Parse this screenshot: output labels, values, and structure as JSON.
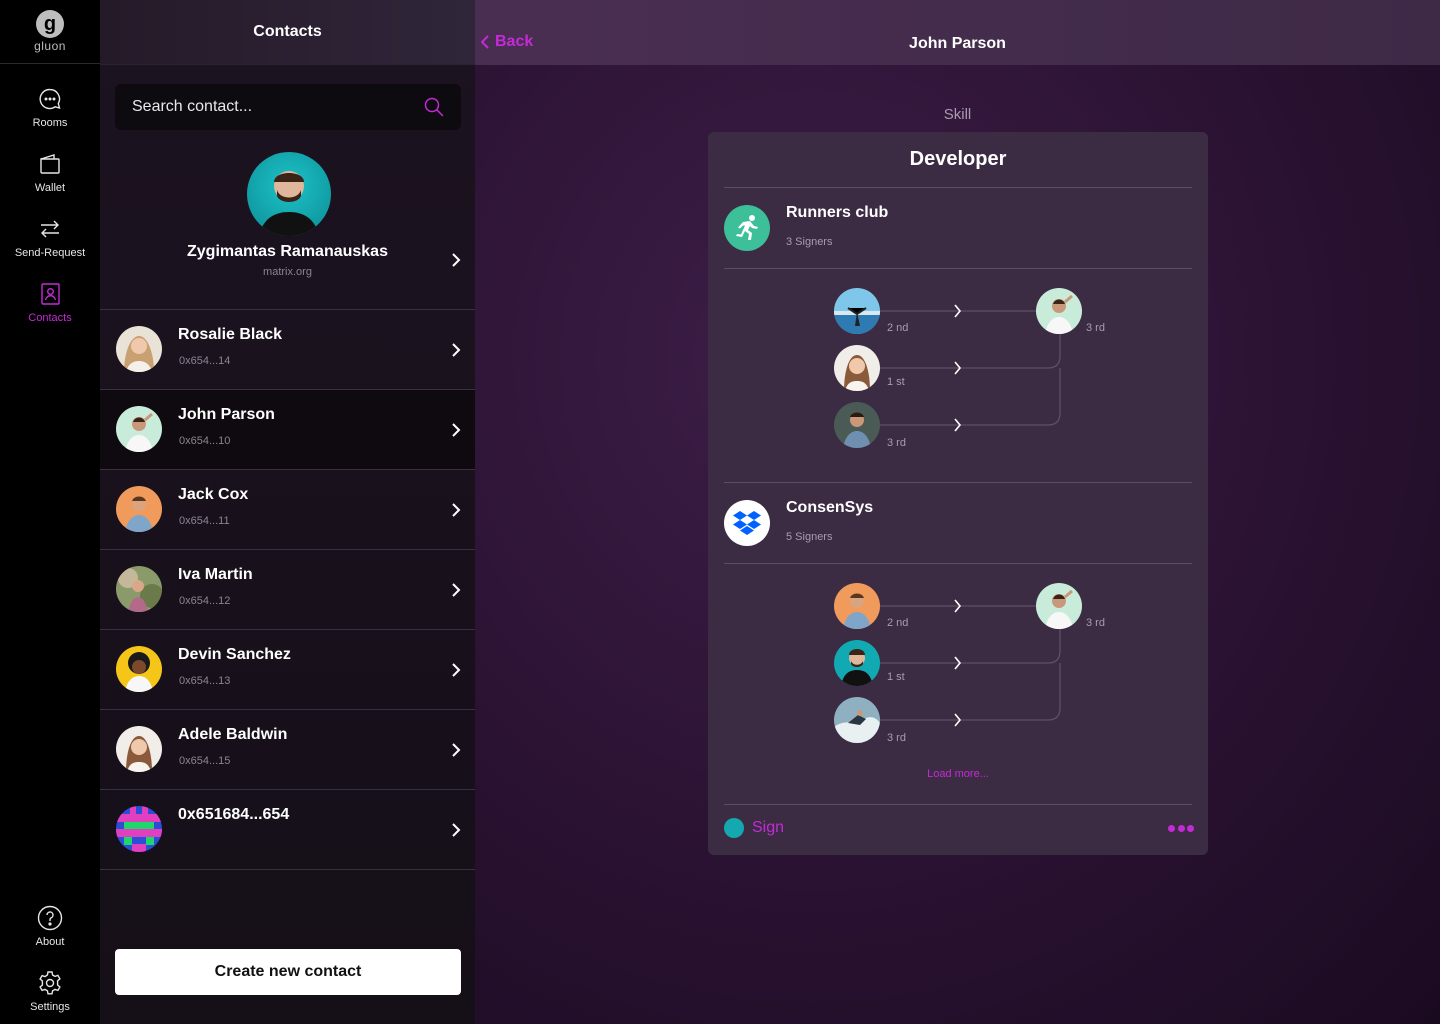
{
  "app": {
    "logo_letter": "g",
    "logo_text": "gluon"
  },
  "nav": {
    "items": [
      {
        "label": "Rooms",
        "icon": "chat-bubble-icon"
      },
      {
        "label": "Wallet",
        "icon": "wallet-icon"
      },
      {
        "label": "Send-Request",
        "icon": "arrows-swap-icon"
      },
      {
        "label": "Contacts",
        "icon": "contacts-book-icon",
        "active": true
      }
    ],
    "bottom": [
      {
        "label": "About",
        "icon": "question-icon"
      },
      {
        "label": "Settings",
        "icon": "gear-icon"
      }
    ]
  },
  "contacts": {
    "title": "Contacts",
    "search_placeholder": "Search contact...",
    "profile": {
      "name": "Zygimantas Ramanauskas",
      "server": "matrix.org"
    },
    "list": [
      {
        "name": "Rosalie Black",
        "address": "0x654...14"
      },
      {
        "name": "John Parson",
        "address": "0x654...10",
        "selected": true
      },
      {
        "name": "Jack Cox",
        "address": "0x654...11"
      },
      {
        "name": "Iva Martin",
        "address": "0x654...12"
      },
      {
        "name": "Devin Sanchez",
        "address": "0x654...13"
      },
      {
        "name": "Adele Baldwin",
        "address": "0x654...15"
      },
      {
        "name": "0x651684...654",
        "address": ""
      }
    ],
    "create_label": "Create new contact"
  },
  "detail": {
    "back_label": "Back",
    "title": "John Parson",
    "section_label": "Skill",
    "skill": "Developer",
    "orgs": [
      {
        "name": "Runners club",
        "signers": "3 Signers",
        "icon": "runner-icon",
        "icon_color": "#3dbf9a",
        "signer_ranks": [
          "2 nd",
          "1 st",
          "3 rd"
        ],
        "target_rank": "3 rd"
      },
      {
        "name": "ConsenSys",
        "signers": "5 Signers",
        "icon": "dropbox-icon",
        "icon_color": "#ffffff",
        "signer_ranks": [
          "2 nd",
          "1 st",
          "3 rd"
        ],
        "target_rank": "3 rd"
      }
    ],
    "load_more": "Load more...",
    "sign_label": "Sign"
  },
  "colors": {
    "accent": "#c32bd6"
  }
}
